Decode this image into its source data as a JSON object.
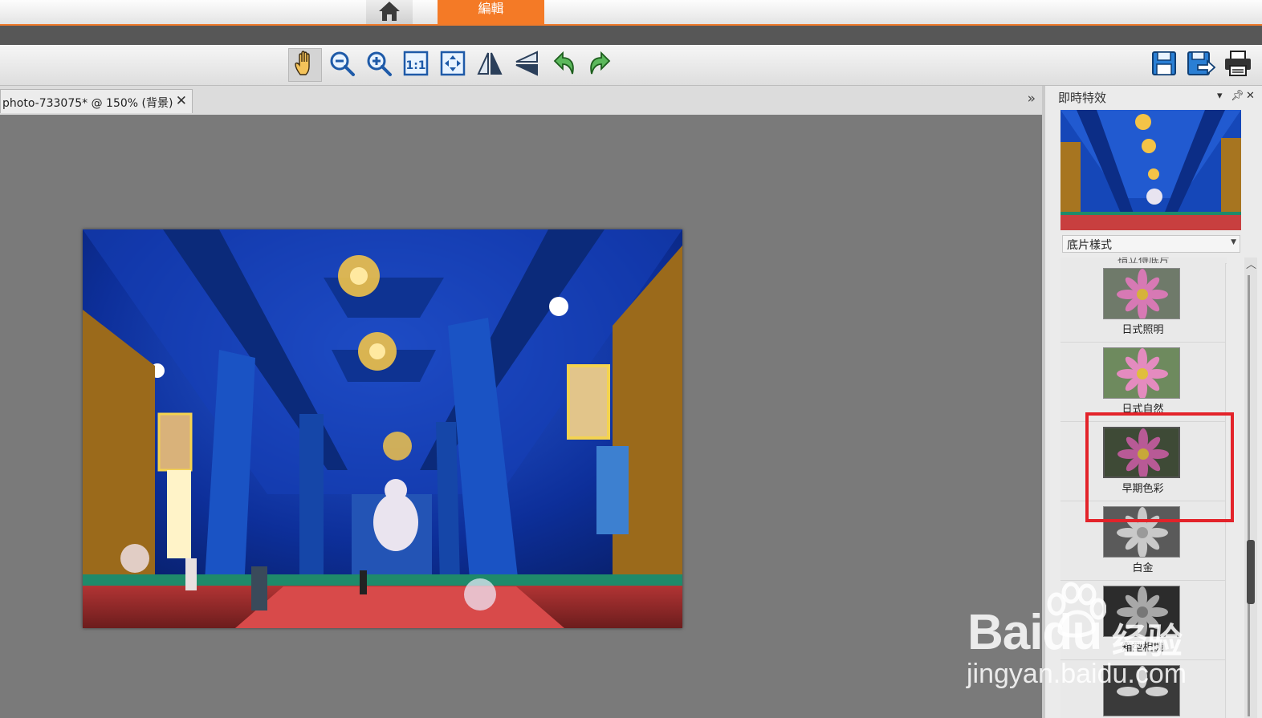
{
  "tabs": {
    "edit_label": "編輯"
  },
  "document": {
    "tab_label": "photo-733075* @ 150% (背景)"
  },
  "panel": {
    "title": "即時特效",
    "style_select": "底片樣式",
    "presets": [
      {
        "label": "日式照明"
      },
      {
        "label": "日式自然"
      },
      {
        "label": "早期色彩"
      },
      {
        "label": "白金"
      },
      {
        "label": "箱型相機"
      }
    ],
    "partial_above_label": "指立得底片"
  },
  "watermark": {
    "brand": "Bai",
    "brand_suffix": "du",
    "cn": "经验",
    "url": "jingyan.baidu.com"
  },
  "colors": {
    "accent": "#f47a26",
    "highlight": "#e3232a"
  },
  "icons": [
    "home-icon",
    "hand-icon",
    "zoom-out-icon",
    "zoom-in-icon",
    "actual-size-icon",
    "fit-screen-icon",
    "flip-horizontal-icon",
    "flip-vertical-icon",
    "undo-icon",
    "redo-icon",
    "save-icon",
    "save-as-icon",
    "print-icon"
  ]
}
